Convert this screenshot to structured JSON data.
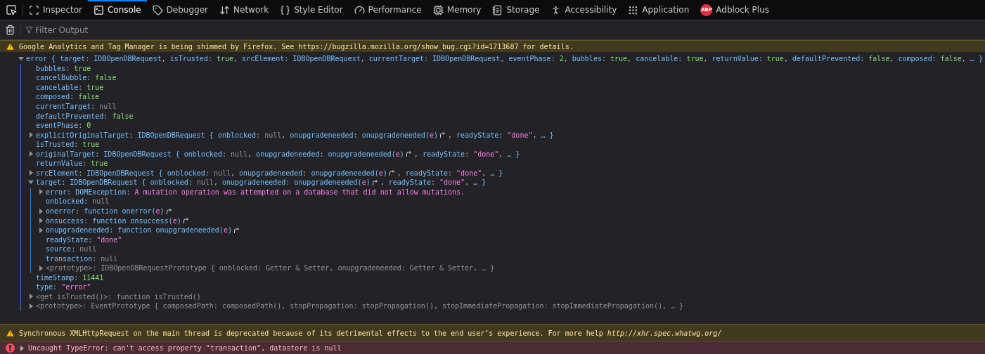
{
  "tabs": [
    {
      "label": "Inspector",
      "selected": false
    },
    {
      "label": "Console",
      "selected": true
    },
    {
      "label": "Debugger",
      "selected": false
    },
    {
      "label": "Network",
      "selected": false
    },
    {
      "label": "Style Editor",
      "selected": false
    },
    {
      "label": "Performance",
      "selected": false
    },
    {
      "label": "Memory",
      "selected": false
    },
    {
      "label": "Storage",
      "selected": false
    },
    {
      "label": "Accessibility",
      "selected": false
    },
    {
      "label": "Application",
      "selected": false
    },
    {
      "label": "Adblock Plus",
      "selected": false,
      "badge": "ABP"
    }
  ],
  "filter": {
    "placeholder": "Filter Output"
  },
  "messages": [
    {
      "kind": "warning",
      "text": "Google Analytics and Tag Manager is being shimmed by Firefox. See https://bugzilla.mozilla.org/show_bug.cgi?id=1713687 for details."
    },
    {
      "kind": "object",
      "tree": [
        {
          "expanded": true,
          "t": [
            {
              "kind": "object",
              "text": "error { "
            },
            {
              "kind": "key",
              "text": "target"
            },
            {
              "kind": "punct",
              "text": ": "
            },
            {
              "kind": "object",
              "text": "IDBOpenDBRequest"
            },
            {
              "kind": "punct",
              "text": ", "
            },
            {
              "kind": "key",
              "text": "isTrusted"
            },
            {
              "kind": "punct",
              "text": ": "
            },
            {
              "kind": "value",
              "text": "true"
            },
            {
              "kind": "punct",
              "text": ", "
            },
            {
              "kind": "key",
              "text": "srcElement"
            },
            {
              "kind": "punct",
              "text": ": "
            },
            {
              "kind": "object",
              "text": "IDBOpenDBRequest"
            },
            {
              "kind": "punct",
              "text": ", "
            },
            {
              "kind": "key",
              "text": "currentTarget"
            },
            {
              "kind": "punct",
              "text": ": "
            },
            {
              "kind": "object",
              "text": "IDBOpenDBRequest"
            },
            {
              "kind": "punct",
              "text": ", "
            },
            {
              "kind": "key",
              "text": "eventPhase"
            },
            {
              "kind": "punct",
              "text": ": "
            },
            {
              "kind": "value",
              "text": "2"
            },
            {
              "kind": "punct",
              "text": ", "
            },
            {
              "kind": "key",
              "text": "bubbles"
            },
            {
              "kind": "punct",
              "text": ": "
            },
            {
              "kind": "value",
              "text": "true"
            },
            {
              "kind": "punct",
              "text": ", "
            },
            {
              "kind": "key",
              "text": "cancelable"
            },
            {
              "kind": "punct",
              "text": ": "
            },
            {
              "kind": "value",
              "text": "true"
            },
            {
              "kind": "punct",
              "text": ", "
            },
            {
              "kind": "key",
              "text": "returnValue"
            },
            {
              "kind": "punct",
              "text": ": "
            },
            {
              "kind": "value",
              "text": "true"
            },
            {
              "kind": "punct",
              "text": ", "
            },
            {
              "kind": "key",
              "text": "defaultPrevented"
            },
            {
              "kind": "punct",
              "text": ": "
            },
            {
              "kind": "value",
              "text": "false"
            },
            {
              "kind": "punct",
              "text": ", "
            },
            {
              "kind": "key",
              "text": "composed"
            },
            {
              "kind": "punct",
              "text": ": "
            },
            {
              "kind": "value",
              "text": "false"
            },
            {
              "kind": "punct",
              "text": ", "
            },
            {
              "kind": "object",
              "text": "… }"
            }
          ],
          "children": [
            {
              "t": [
                {
                  "kind": "key",
                  "text": "bubbles"
                },
                {
                  "kind": "punct",
                  "text": ": "
                },
                {
                  "kind": "value",
                  "text": "true"
                }
              ]
            },
            {
              "t": [
                {
                  "kind": "key",
                  "text": "cancelBubble"
                },
                {
                  "kind": "punct",
                  "text": ": "
                },
                {
                  "kind": "value",
                  "text": "false"
                }
              ]
            },
            {
              "t": [
                {
                  "kind": "key",
                  "text": "cancelable"
                },
                {
                  "kind": "punct",
                  "text": ": "
                },
                {
                  "kind": "value",
                  "text": "true"
                }
              ]
            },
            {
              "t": [
                {
                  "kind": "key",
                  "text": "composed"
                },
                {
                  "kind": "punct",
                  "text": ": "
                },
                {
                  "kind": "value",
                  "text": "false"
                }
              ]
            },
            {
              "t": [
                {
                  "kind": "key",
                  "text": "currentTarget"
                },
                {
                  "kind": "punct",
                  "text": ": "
                },
                {
                  "kind": "null",
                  "text": "null"
                }
              ]
            },
            {
              "t": [
                {
                  "kind": "key",
                  "text": "defaultPrevented"
                },
                {
                  "kind": "punct",
                  "text": ": "
                },
                {
                  "kind": "value",
                  "text": "false"
                }
              ]
            },
            {
              "t": [
                {
                  "kind": "key",
                  "text": "eventPhase"
                },
                {
                  "kind": "punct",
                  "text": ": "
                },
                {
                  "kind": "value",
                  "text": "0"
                }
              ]
            },
            {
              "expanded": false,
              "t": [
                {
                  "kind": "key",
                  "text": "explicitOriginalTarget"
                },
                {
                  "kind": "punct",
                  "text": ": "
                },
                {
                  "kind": "object",
                  "text": "IDBOpenDBRequest { "
                },
                {
                  "kind": "key",
                  "text": "onblocked"
                },
                {
                  "kind": "punct",
                  "text": ": "
                },
                {
                  "kind": "null",
                  "text": "null"
                },
                {
                  "kind": "punct",
                  "text": ", "
                },
                {
                  "kind": "key",
                  "text": "onupgradeneeded"
                },
                {
                  "kind": "punct",
                  "text": ": "
                },
                {
                  "kind": "object",
                  "text": "onupgradeneeded("
                },
                {
                  "kind": "string",
                  "text": "e"
                },
                {
                  "kind": "object",
                  "text": ")"
                },
                {
                  "kind": "jump"
                },
                {
                  "kind": "punct",
                  "text": ", "
                },
                {
                  "kind": "key",
                  "text": "readyState"
                },
                {
                  "kind": "punct",
                  "text": ": "
                },
                {
                  "kind": "string",
                  "text": "\"done\""
                },
                {
                  "kind": "punct",
                  "text": ", "
                },
                {
                  "kind": "object",
                  "text": "… }"
                }
              ]
            },
            {
              "t": [
                {
                  "kind": "key",
                  "text": "isTrusted"
                },
                {
                  "kind": "punct",
                  "text": ": "
                },
                {
                  "kind": "value",
                  "text": "true"
                }
              ]
            },
            {
              "expanded": false,
              "t": [
                {
                  "kind": "key",
                  "text": "originalTarget"
                },
                {
                  "kind": "punct",
                  "text": ": "
                },
                {
                  "kind": "object",
                  "text": "IDBOpenDBRequest { "
                },
                {
                  "kind": "key",
                  "text": "onblocked"
                },
                {
                  "kind": "punct",
                  "text": ": "
                },
                {
                  "kind": "null",
                  "text": "null"
                },
                {
                  "kind": "punct",
                  "text": ", "
                },
                {
                  "kind": "key",
                  "text": "onupgradeneeded"
                },
                {
                  "kind": "punct",
                  "text": ": "
                },
                {
                  "kind": "object",
                  "text": "onupgradeneeded("
                },
                {
                  "kind": "string",
                  "text": "e"
                },
                {
                  "kind": "object",
                  "text": ")"
                },
                {
                  "kind": "jump"
                },
                {
                  "kind": "punct",
                  "text": ", "
                },
                {
                  "kind": "key",
                  "text": "readyState"
                },
                {
                  "kind": "punct",
                  "text": ": "
                },
                {
                  "kind": "string",
                  "text": "\"done\""
                },
                {
                  "kind": "punct",
                  "text": ", "
                },
                {
                  "kind": "object",
                  "text": "… }"
                }
              ]
            },
            {
              "t": [
                {
                  "kind": "key",
                  "text": "returnValue"
                },
                {
                  "kind": "punct",
                  "text": ": "
                },
                {
                  "kind": "value",
                  "text": "true"
                }
              ]
            },
            {
              "expanded": false,
              "t": [
                {
                  "kind": "key",
                  "text": "srcElement"
                },
                {
                  "kind": "punct",
                  "text": ": "
                },
                {
                  "kind": "object",
                  "text": "IDBOpenDBRequest { "
                },
                {
                  "kind": "key",
                  "text": "onblocked"
                },
                {
                  "kind": "punct",
                  "text": ": "
                },
                {
                  "kind": "null",
                  "text": "null"
                },
                {
                  "kind": "punct",
                  "text": ", "
                },
                {
                  "kind": "key",
                  "text": "onupgradeneeded"
                },
                {
                  "kind": "punct",
                  "text": ": "
                },
                {
                  "kind": "object",
                  "text": "onupgradeneeded("
                },
                {
                  "kind": "string",
                  "text": "e"
                },
                {
                  "kind": "object",
                  "text": ")"
                },
                {
                  "kind": "jump"
                },
                {
                  "kind": "punct",
                  "text": ", "
                },
                {
                  "kind": "key",
                  "text": "readyState"
                },
                {
                  "kind": "punct",
                  "text": ": "
                },
                {
                  "kind": "string",
                  "text": "\"done\""
                },
                {
                  "kind": "punct",
                  "text": ", "
                },
                {
                  "kind": "object",
                  "text": "… }"
                }
              ]
            },
            {
              "expanded": true,
              "t": [
                {
                  "kind": "key",
                  "text": "target"
                },
                {
                  "kind": "punct",
                  "text": ": "
                },
                {
                  "kind": "object",
                  "text": "IDBOpenDBRequest { "
                },
                {
                  "kind": "key",
                  "text": "onblocked"
                },
                {
                  "kind": "punct",
                  "text": ": "
                },
                {
                  "kind": "null",
                  "text": "null"
                },
                {
                  "kind": "punct",
                  "text": ", "
                },
                {
                  "kind": "key",
                  "text": "onupgradeneeded"
                },
                {
                  "kind": "punct",
                  "text": ": "
                },
                {
                  "kind": "object",
                  "text": "onupgradeneeded("
                },
                {
                  "kind": "string",
                  "text": "e"
                },
                {
                  "kind": "object",
                  "text": ")"
                },
                {
                  "kind": "jump"
                },
                {
                  "kind": "punct",
                  "text": ", "
                },
                {
                  "kind": "key",
                  "text": "readyState"
                },
                {
                  "kind": "punct",
                  "text": ": "
                },
                {
                  "kind": "string",
                  "text": "\"done\""
                },
                {
                  "kind": "punct",
                  "text": ", "
                },
                {
                  "kind": "object",
                  "text": "… }"
                }
              ],
              "children": [
                {
                  "expanded": false,
                  "t": [
                    {
                      "kind": "key",
                      "text": "error"
                    },
                    {
                      "kind": "punct",
                      "text": ": "
                    },
                    {
                      "kind": "object",
                      "text": "DOMException: "
                    },
                    {
                      "kind": "string",
                      "text": "A mutation operation was attempted on a database that did not allow mutations."
                    }
                  ]
                },
                {
                  "t": [
                    {
                      "kind": "key",
                      "text": "onblocked"
                    },
                    {
                      "kind": "punct",
                      "text": ": "
                    },
                    {
                      "kind": "null",
                      "text": "null"
                    }
                  ]
                },
                {
                  "expanded": false,
                  "t": [
                    {
                      "kind": "key",
                      "text": "onerror"
                    },
                    {
                      "kind": "punct",
                      "text": ": "
                    },
                    {
                      "kind": "object",
                      "text": "function onerror("
                    },
                    {
                      "kind": "string",
                      "text": "e"
                    },
                    {
                      "kind": "object",
                      "text": ")"
                    },
                    {
                      "kind": "jump"
                    }
                  ]
                },
                {
                  "expanded": false,
                  "t": [
                    {
                      "kind": "key",
                      "text": "onsuccess"
                    },
                    {
                      "kind": "punct",
                      "text": ": "
                    },
                    {
                      "kind": "object",
                      "text": "function onsuccess("
                    },
                    {
                      "kind": "string",
                      "text": "e"
                    },
                    {
                      "kind": "object",
                      "text": ")"
                    },
                    {
                      "kind": "jump"
                    }
                  ]
                },
                {
                  "expanded": false,
                  "t": [
                    {
                      "kind": "key",
                      "text": "onupgradeneeded"
                    },
                    {
                      "kind": "punct",
                      "text": ": "
                    },
                    {
                      "kind": "object",
                      "text": "function onupgradeneeded("
                    },
                    {
                      "kind": "string",
                      "text": "e"
                    },
                    {
                      "kind": "object",
                      "text": ")"
                    },
                    {
                      "kind": "jump"
                    }
                  ]
                },
                {
                  "t": [
                    {
                      "kind": "key",
                      "text": "readyState"
                    },
                    {
                      "kind": "punct",
                      "text": ": "
                    },
                    {
                      "kind": "string",
                      "text": "\"done\""
                    }
                  ]
                },
                {
                  "t": [
                    {
                      "kind": "key",
                      "text": "source"
                    },
                    {
                      "kind": "punct",
                      "text": ": "
                    },
                    {
                      "kind": "null",
                      "text": "null"
                    }
                  ]
                },
                {
                  "t": [
                    {
                      "kind": "key",
                      "text": "transaction"
                    },
                    {
                      "kind": "punct",
                      "text": ": "
                    },
                    {
                      "kind": "null",
                      "text": "null"
                    }
                  ]
                },
                {
                  "expanded": false,
                  "t": [
                    {
                      "kind": "gray",
                      "text": "<prototype>: IDBOpenDBRequestPrototype { onblocked: Getter & Setter, onupgradeneeded: Getter & Setter, … }"
                    }
                  ]
                }
              ]
            },
            {
              "t": [
                {
                  "kind": "key",
                  "text": "timeStamp"
                },
                {
                  "kind": "punct",
                  "text": ": "
                },
                {
                  "kind": "value",
                  "text": "11441"
                }
              ]
            },
            {
              "t": [
                {
                  "kind": "key",
                  "text": "type"
                },
                {
                  "kind": "punct",
                  "text": ": "
                },
                {
                  "kind": "string",
                  "text": "\"error\""
                }
              ]
            },
            {
              "expanded": false,
              "t": [
                {
                  "kind": "gray",
                  "text": "<get isTrusted()>: function isTrusted()"
                }
              ]
            },
            {
              "expanded": false,
              "t": [
                {
                  "kind": "gray",
                  "text": "<prototype>: EventPrototype { composedPath: composedPath(), stopPropagation: stopPropagation(), stopImmediatePropagation: stopImmediatePropagation(), … }"
                }
              ]
            }
          ]
        }
      ]
    },
    {
      "kind": "warning",
      "text": "Synchronous XMLHttpRequest on the main thread is deprecated because of its detrimental effects to the end user’s experience. For more help ",
      "link": "http://xhr.spec.whatwg.org/"
    },
    {
      "kind": "error",
      "expanded": false,
      "text": "Uncaught TypeError: can't access property \"transaction\", datastore is null"
    }
  ]
}
